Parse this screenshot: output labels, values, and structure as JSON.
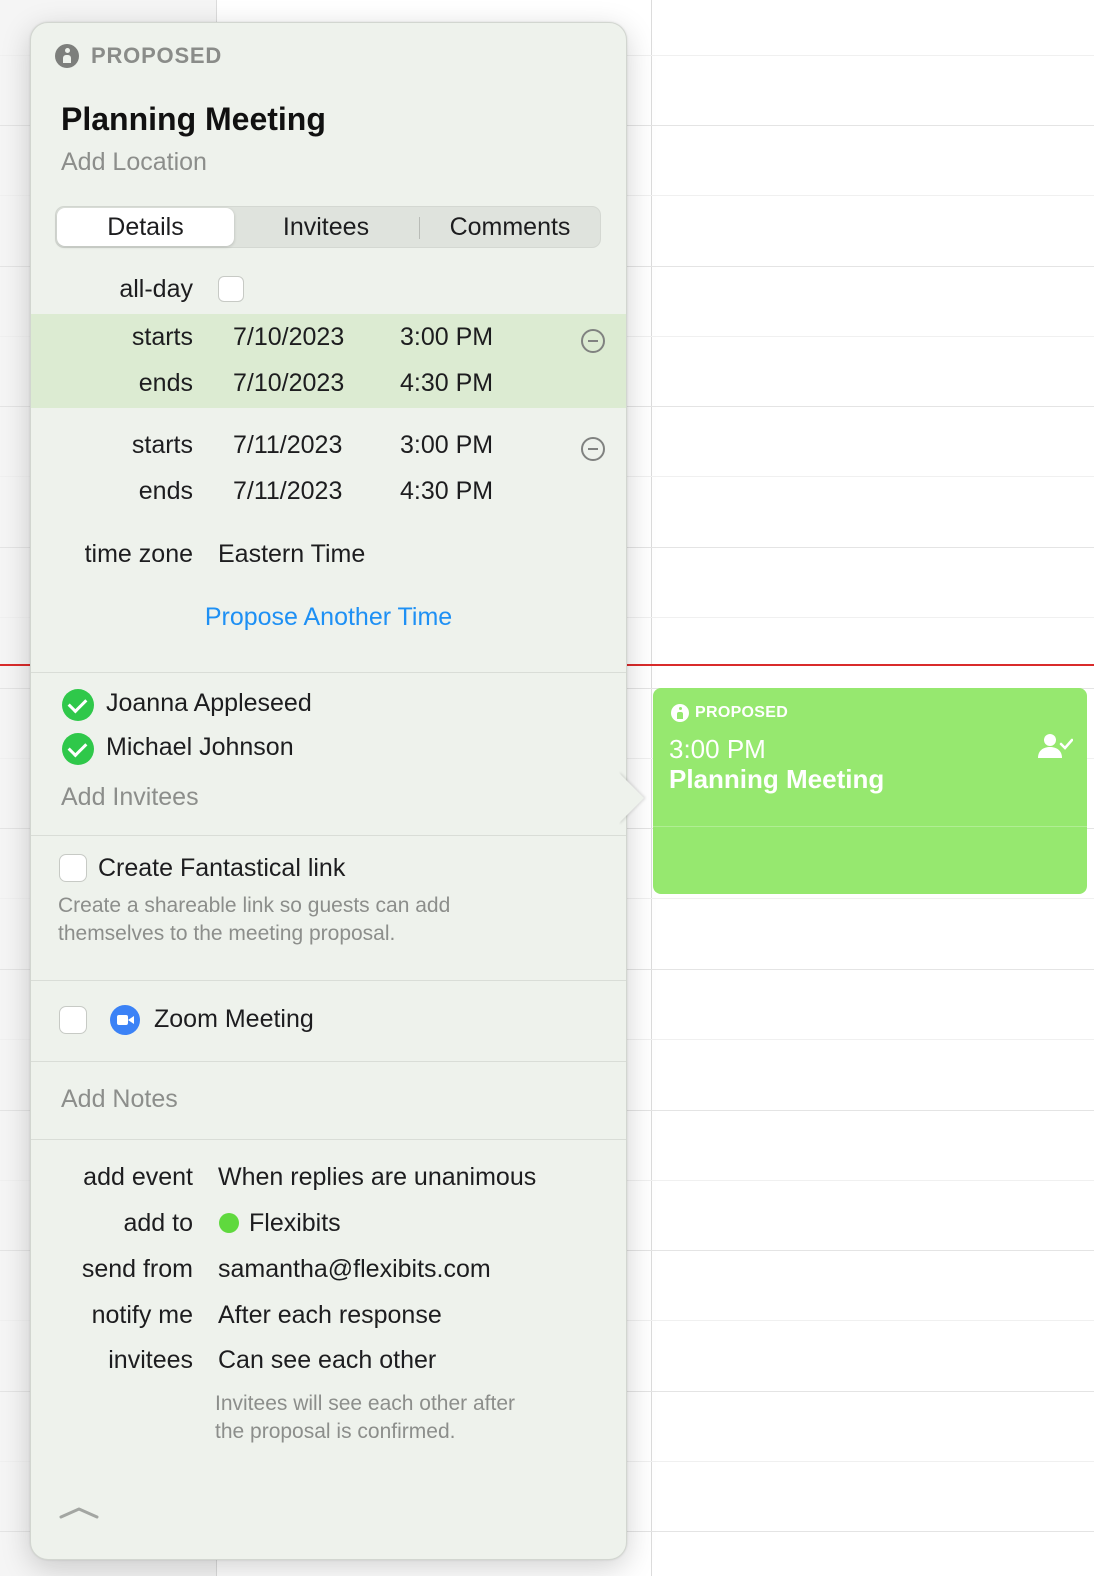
{
  "event_block": {
    "status": "PROPOSED",
    "time": "3:00 PM",
    "title": "Planning Meeting",
    "color": "#96e86f"
  },
  "popover": {
    "status": "PROPOSED",
    "title": "Planning Meeting",
    "location_placeholder": "Add Location",
    "tabs": [
      {
        "label": "Details",
        "active": true
      },
      {
        "label": "Invitees",
        "active": false
      },
      {
        "label": "Comments",
        "active": false
      }
    ],
    "all_day_label": "all-day",
    "time_slots": [
      {
        "starts_label": "starts",
        "ends_label": "ends",
        "start_date": "7/10/2023",
        "start_time": "3:00 PM",
        "end_date": "7/10/2023",
        "end_time": "4:30 PM",
        "highlighted": true
      },
      {
        "starts_label": "starts",
        "ends_label": "ends",
        "start_date": "7/11/2023",
        "start_time": "3:00 PM",
        "end_date": "7/11/2023",
        "end_time": "4:30 PM",
        "highlighted": false
      }
    ],
    "time_zone_label": "time zone",
    "time_zone_value": "Eastern Time",
    "propose_link": "Propose Another Time",
    "invitees": [
      {
        "name": "Joanna Appleseed",
        "status": "accepted"
      },
      {
        "name": "Michael Johnson",
        "status": "accepted"
      }
    ],
    "add_invitees": "Add Invitees",
    "fantastical_link_label": "Create Fantastical link",
    "fantastical_link_help_1": "Create a shareable link so guests can add",
    "fantastical_link_help_2": "themselves to the meeting proposal.",
    "zoom_label": "Zoom Meeting",
    "notes_placeholder": "Add Notes",
    "settings": [
      {
        "label": "add event",
        "value": "When replies are unanimous"
      },
      {
        "label": "add to",
        "value": "Flexibits",
        "dot_color": "#5fd93e"
      },
      {
        "label": "send from",
        "value": "samantha@flexibits.com"
      },
      {
        "label": "notify me",
        "value": "After each response"
      },
      {
        "label": "invitees",
        "value": "Can see each other"
      }
    ],
    "invitees_help_1": "Invitees will see each other after",
    "invitees_help_2": "the proposal is confirmed.",
    "accent": "#1e90f4"
  }
}
